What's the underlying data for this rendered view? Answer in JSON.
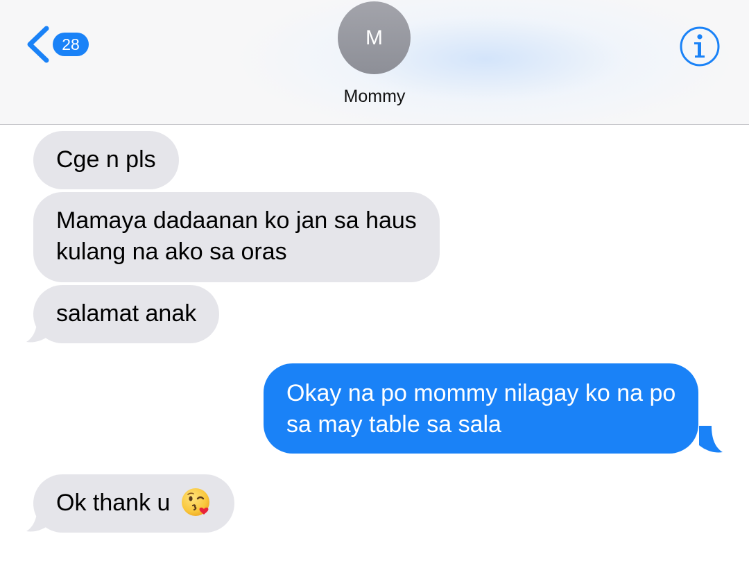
{
  "header": {
    "back_badge_count": "28",
    "contact_initial": "M",
    "contact_name": "Mommy"
  },
  "colors": {
    "accent": "#1a82f7",
    "incoming_bubble": "#e5e5ea",
    "outgoing_bubble": "#1a82f7",
    "avatar": "#9a9ba2"
  },
  "icons": {
    "back": "chevron-left-icon",
    "info": "info-icon",
    "emoji": "face-blowing-kiss-emoji"
  },
  "messages": [
    {
      "direction": "incoming",
      "lines": [
        "Cge n pls"
      ]
    },
    {
      "direction": "incoming",
      "lines": [
        "Mamaya dadaanan ko jan sa haus",
        "kulang na ako sa oras"
      ]
    },
    {
      "direction": "incoming",
      "lines": [
        "salamat anak"
      ]
    },
    {
      "direction": "outgoing",
      "lines": [
        "Okay na po mommy nilagay ko na po",
        "sa may table sa sala"
      ]
    },
    {
      "direction": "incoming",
      "lines": [
        "Ok thank u"
      ],
      "emoji": "😘"
    }
  ]
}
